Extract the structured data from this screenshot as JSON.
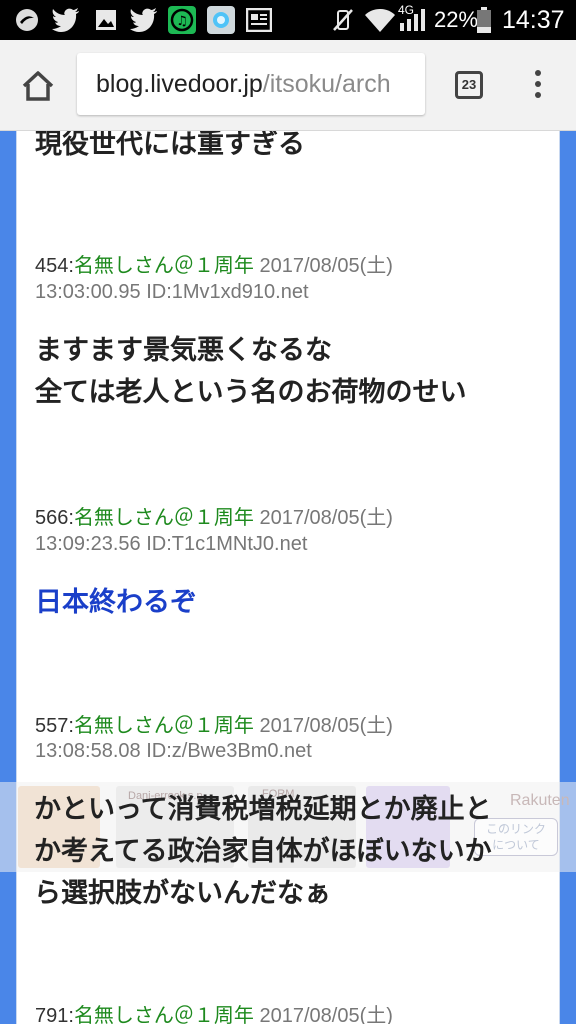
{
  "status_bar": {
    "network_label": "4G",
    "battery_percent": "22%",
    "time": "14:37"
  },
  "browser": {
    "url_domain": "blog.livedoor.jp",
    "url_path": "/itsoku/arch",
    "tab_count": "23"
  },
  "page": {
    "partial_top_text": "現役世代には重すぎる",
    "posts": [
      {
        "number": "454:",
        "name": "名無しさん＠１周年",
        "date": "2017/08/05(土)",
        "time_id": "13:03:00.95 ID:1Mv1xd910.net",
        "body_lines": [
          "ますます景気悪くなるな",
          "全ては老人という名のお荷物のせい"
        ]
      },
      {
        "number": "566:",
        "name": "名無しさん＠１周年",
        "date": "2017/08/05(土)",
        "time_id": "13:09:23.56 ID:T1c1MNtJ0.net",
        "body_lines": [
          "日本終わるぞ"
        ]
      },
      {
        "number": "557:",
        "name": "名無しさん＠１周年",
        "date": "2017/08/05(土)",
        "time_id": "13:08:58.08 ID:z/Bwe3Bm0.net",
        "body_lines": [
          "かといって消費税増税延期とか廃止と",
          "か考えてる政治家自体がほぼいないか",
          "ら選択肢がないんだなぁ"
        ]
      },
      {
        "number": "791:",
        "name": "名無しさん＠１周年",
        "date": "2017/08/05(土)"
      }
    ]
  },
  "ad": {
    "label_1": "Dani-errock.s.p",
    "label_2": "FORM",
    "brand": "Rakuten",
    "link_text": "このリンク\nについて"
  },
  "colors": {
    "frame_blue": "#4a86e8",
    "name_green": "#1e8a1e",
    "emphasis_blue": "#1a3fc9"
  }
}
